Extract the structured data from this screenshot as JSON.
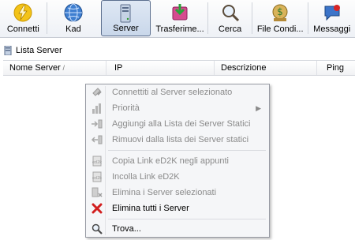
{
  "toolbar": {
    "buttons": [
      {
        "label": "Connetti",
        "icon": "lightning-icon"
      },
      {
        "label": "Kad",
        "icon": "globe-icon"
      },
      {
        "label": "Server",
        "icon": "server-icon",
        "active": true
      },
      {
        "label": "Trasferime...",
        "icon": "transfer-icon"
      },
      {
        "label": "Cerca",
        "icon": "search-icon"
      },
      {
        "label": "File Condi...",
        "icon": "shared-files-icon"
      },
      {
        "label": "Messaggi",
        "icon": "messages-icon"
      }
    ]
  },
  "list": {
    "label": "Lista Server"
  },
  "table": {
    "columns": [
      "Nome Server",
      "IP",
      "Descrizione",
      "Ping"
    ],
    "sort_indicator": "/"
  },
  "menu": {
    "items": [
      {
        "label": "Connettiti al Server selezionato",
        "icon": "connect-server-icon",
        "disabled": true
      },
      {
        "label": "Priorità",
        "icon": "priority-icon",
        "disabled": true,
        "submenu": true
      },
      {
        "label": "Aggiungi alla Lista dei Server Statici",
        "icon": "add-static-icon",
        "disabled": true
      },
      {
        "label": "Rimuovi dalla lista dei Server statici",
        "icon": "remove-static-icon",
        "disabled": true
      },
      {
        "label": "Copia Link eD2K negli appunti",
        "icon": "copy-link-icon",
        "disabled": true
      },
      {
        "label": "Incolla Link eD2K",
        "icon": "paste-link-icon",
        "disabled": true
      },
      {
        "label": "Elimina i Server selezionati",
        "icon": "delete-selected-icon",
        "disabled": true
      },
      {
        "label": "Elimina tutti i Server",
        "icon": "delete-all-icon",
        "disabled": false
      },
      {
        "label": "Trova...",
        "icon": "find-icon",
        "disabled": false
      }
    ],
    "submenu_arrow": "▶"
  },
  "colors": {
    "accent": "#5c6f8e",
    "delete": "#d21f1f",
    "disabled_text": "#8a8a8a"
  }
}
